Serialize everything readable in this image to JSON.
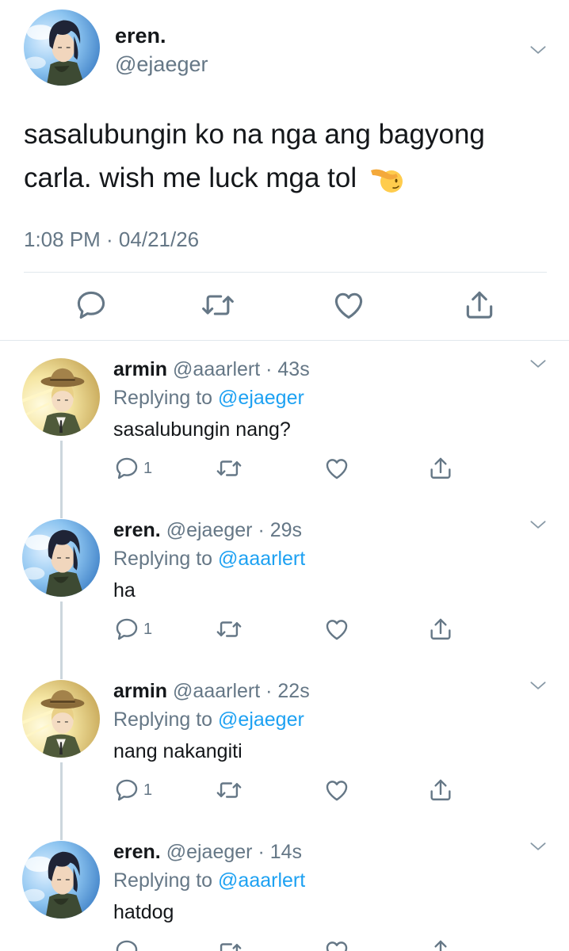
{
  "main": {
    "name": "eren.",
    "handle": "@ejaeger",
    "text_line1": "sasalubungin ko na nga ang bagyong",
    "text_line2": "carla. wish me luck mga tol",
    "time": "1:08 PM · 04/21/26",
    "emoji": "saluting-face-emoji"
  },
  "replies": [
    {
      "name": "armin",
      "handle": "@aaarlert · 43s",
      "replying_prefix": "Replying to",
      "mention": "@ejaeger",
      "text": "sasalubungin nang?",
      "reply_count": "1"
    },
    {
      "name": "eren.",
      "handle": "@ejaeger · 29s",
      "replying_prefix": "Replying to",
      "mention": "@aaarlert",
      "text": "ha",
      "reply_count": "1"
    },
    {
      "name": "armin",
      "handle": "@aaarlert · 22s",
      "replying_prefix": "Replying to",
      "mention": "@ejaeger",
      "text": "nang nakangiti",
      "reply_count": "1"
    },
    {
      "name": "eren.",
      "handle": "@ejaeger · 14s",
      "replying_prefix": "Replying to",
      "mention": "@aaarlert",
      "text": "hatdog",
      "reply_count": ""
    }
  ],
  "colors": {
    "link": "#1da1f2",
    "secondary_text": "#657786",
    "divider": "#e1e8ed",
    "thread_line": "#ccd6dd"
  },
  "icons": [
    "reply-icon",
    "retweet-icon",
    "like-icon",
    "share-icon",
    "chevron-down-icon"
  ]
}
